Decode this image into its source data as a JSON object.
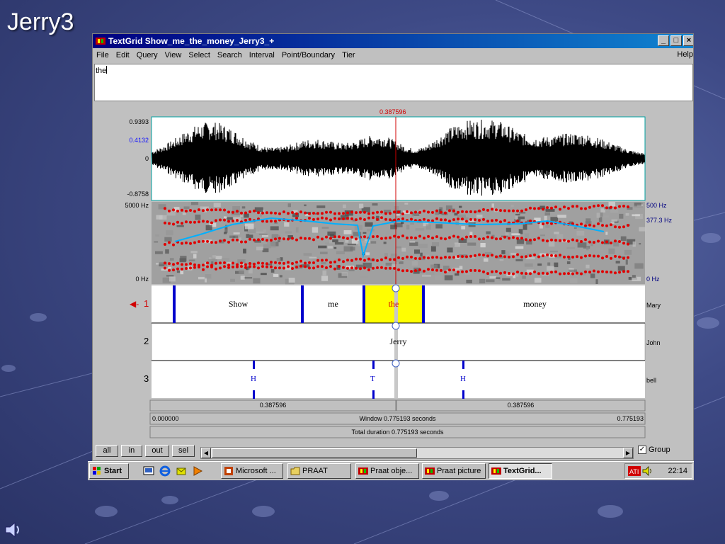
{
  "slide": {
    "title": "Jerry3"
  },
  "window": {
    "title": "TextGrid Show_me_the_money_Jerry3_+",
    "controls": {
      "minimize": "_",
      "maximize": "□",
      "close": "×"
    }
  },
  "menu": {
    "items": [
      "File",
      "Edit",
      "Query",
      "View",
      "Select",
      "Search",
      "Interval",
      "Point/Boundary",
      "Tier"
    ],
    "help": "Help"
  },
  "text_area": {
    "value": "the"
  },
  "editor": {
    "cursor_time": "0.387596",
    "waveform": {
      "max": "0.9393",
      "cursor_value": "0.4132",
      "zero": "0",
      "min": "-0.8758"
    },
    "spectrogram": {
      "freq_top": "5000 Hz",
      "freq_bottom": "0 Hz",
      "pitch_top": "500 Hz",
      "pitch_value": "377.3 Hz",
      "pitch_bottom": "0 Hz"
    },
    "tiers": [
      {
        "number": "1",
        "name": "Mary",
        "intervals": [
          "Show",
          "me",
          "the",
          "money"
        ]
      },
      {
        "number": "2",
        "name": "John",
        "intervals": [
          "Jerry"
        ]
      },
      {
        "number": "3",
        "name": "bell",
        "points": [
          "H",
          "T",
          "H"
        ]
      }
    ],
    "bars": {
      "left_duration": "0.387596",
      "right_duration": "0.387596",
      "window_start": "0.000000",
      "window_text": "Window 0.775193 seconds",
      "window_end": "0.775193",
      "total_text": "Total duration 0.775193 seconds"
    }
  },
  "bottom": {
    "buttons": [
      "all",
      "in",
      "out",
      "sel"
    ],
    "group_label": "Group",
    "group_checked": true
  },
  "taskbar": {
    "start": "Start",
    "items": [
      "Microsoft ...",
      "PRAAT",
      "Praat obje...",
      "Praat picture",
      "TextGrid..."
    ],
    "clock": "22:14"
  },
  "colors": {
    "title_gradient_start": "#000080",
    "title_gradient_end": "#1084d0",
    "boundary": "#0000cc",
    "formant": "#e00000",
    "pitch": "#00b0ff",
    "selection": "#ffff00",
    "cursor": "#d00000"
  }
}
